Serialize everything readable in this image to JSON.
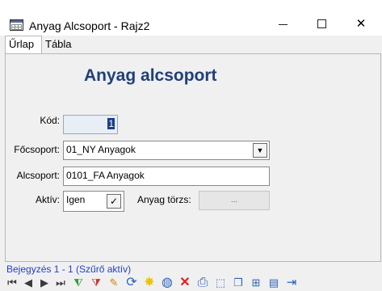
{
  "window": {
    "title": "Anyag Alcsoport - Rajz2",
    "minimize": "—",
    "maximize": "☐",
    "close": "✕"
  },
  "tabs": [
    {
      "label": "Űrlap",
      "active": true
    },
    {
      "label": "Tábla",
      "active": false
    }
  ],
  "form": {
    "heading": "Anyag alcsoport",
    "kod_label": "Kód:",
    "kod_value": "1",
    "focsoport_label": "Főcsoport:",
    "focsoport_value": "01_NY Anyagok",
    "alcsoport_label": "Alcsoport:",
    "alcsoport_value": "0101_FA Anyagok",
    "aktiv_label": "Aktív:",
    "aktiv_value": "Igen",
    "aktiv_torzs_label": "Anyag törzs:",
    "aktiv_torzs_button": "..."
  },
  "status": {
    "text": "Bejegyzés 1 - 1 (Szűrő aktív)"
  },
  "toolbar": {
    "first": "⏮",
    "prev": "◀",
    "next": "▶",
    "last": "⏭",
    "filter_add": "⧨",
    "filter_remove": "⧩",
    "edit": "✎",
    "refresh": "⟳",
    "new": "✸",
    "web": "◍",
    "delete": "✕",
    "print": "⎙",
    "preview": "⬚",
    "copy": "❐",
    "tree": "⊞",
    "export": "▤",
    "exit": "⇥"
  },
  "colors": {
    "heading": "#1f3f7a",
    "status": "#1f3fd0",
    "filter_green": "#2e9d3a",
    "filter_red": "#d03030",
    "refresh_blue": "#2a62b8",
    "new_yellow": "#f2c200",
    "delete_red": "#e02020"
  }
}
